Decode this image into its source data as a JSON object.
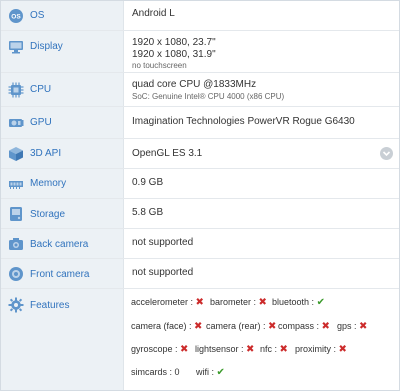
{
  "specs": {
    "os": {
      "label": "OS",
      "value": "Android L"
    },
    "display": {
      "label": "Display",
      "line1": "1920 x 1080, 23.7\"",
      "line2": "1920 x 1080, 31.9\"",
      "line3": "no touchscreen"
    },
    "cpu": {
      "label": "CPU",
      "line1": "quad core CPU @1833MHz",
      "line2": "SoC: Genuine Intel® CPU 4000 (x86 CPU)"
    },
    "gpu": {
      "label": "GPU",
      "value": "Imagination Technologies PowerVR Rogue G6430"
    },
    "api3d": {
      "label": "3D API",
      "value": "OpenGL ES 3.1"
    },
    "memory": {
      "label": "Memory",
      "value": "0.9 GB"
    },
    "storage": {
      "label": "Storage",
      "value": "5.8 GB"
    },
    "back_camera": {
      "label": "Back camera",
      "value": "not supported"
    },
    "front_camera": {
      "label": "Front camera",
      "value": "not supported"
    },
    "features": {
      "label": "Features",
      "items": [
        {
          "name": "accelerometer :",
          "status": "✖"
        },
        {
          "name": "barometer :",
          "status": "✖"
        },
        {
          "name": "bluetooth :",
          "status": "✔"
        },
        {
          "name": "camera (face) :",
          "status": "✖"
        },
        {
          "name": "camera (rear) :",
          "status": "✖"
        },
        {
          "name": "compass :",
          "status": "✖"
        },
        {
          "name": "gps :",
          "status": "✖"
        },
        {
          "name": "gyroscope :",
          "status": "✖"
        },
        {
          "name": "lightsensor :",
          "status": "✖"
        },
        {
          "name": "nfc :",
          "status": "✖"
        },
        {
          "name": "proximity :",
          "status": "✖"
        },
        {
          "name": "simcards : 0",
          "status": ""
        },
        {
          "name": "wifi :",
          "status": "✔"
        }
      ]
    }
  },
  "colors": {
    "label": "#3173bd",
    "icon": "#5f95cb",
    "no": "#cc2b2b",
    "yes": "#3a9a2a",
    "label_bg": "#ecf1f5"
  },
  "icons": {
    "os": "os-badge-icon",
    "display": "monitor-icon",
    "cpu": "cpu-chip-icon",
    "gpu": "gpu-card-icon",
    "api3d": "cube-icon",
    "memory": "memory-icon",
    "storage": "storage-drive-icon",
    "back_camera": "camera-icon",
    "front_camera": "front-camera-icon",
    "features": "gear-icon",
    "expand": "chevron-down-icon"
  }
}
